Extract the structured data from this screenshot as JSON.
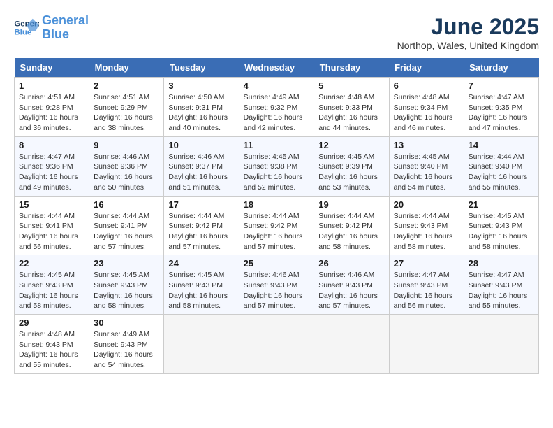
{
  "header": {
    "logo_line1": "General",
    "logo_line2": "Blue",
    "title": "June 2025",
    "subtitle": "Northop, Wales, United Kingdom"
  },
  "days_of_week": [
    "Sunday",
    "Monday",
    "Tuesday",
    "Wednesday",
    "Thursday",
    "Friday",
    "Saturday"
  ],
  "weeks": [
    [
      {
        "day": "1",
        "detail": "Sunrise: 4:51 AM\nSunset: 9:28 PM\nDaylight: 16 hours\nand 36 minutes."
      },
      {
        "day": "2",
        "detail": "Sunrise: 4:51 AM\nSunset: 9:29 PM\nDaylight: 16 hours\nand 38 minutes."
      },
      {
        "day": "3",
        "detail": "Sunrise: 4:50 AM\nSunset: 9:31 PM\nDaylight: 16 hours\nand 40 minutes."
      },
      {
        "day": "4",
        "detail": "Sunrise: 4:49 AM\nSunset: 9:32 PM\nDaylight: 16 hours\nand 42 minutes."
      },
      {
        "day": "5",
        "detail": "Sunrise: 4:48 AM\nSunset: 9:33 PM\nDaylight: 16 hours\nand 44 minutes."
      },
      {
        "day": "6",
        "detail": "Sunrise: 4:48 AM\nSunset: 9:34 PM\nDaylight: 16 hours\nand 46 minutes."
      },
      {
        "day": "7",
        "detail": "Sunrise: 4:47 AM\nSunset: 9:35 PM\nDaylight: 16 hours\nand 47 minutes."
      }
    ],
    [
      {
        "day": "8",
        "detail": "Sunrise: 4:47 AM\nSunset: 9:36 PM\nDaylight: 16 hours\nand 49 minutes."
      },
      {
        "day": "9",
        "detail": "Sunrise: 4:46 AM\nSunset: 9:36 PM\nDaylight: 16 hours\nand 50 minutes."
      },
      {
        "day": "10",
        "detail": "Sunrise: 4:46 AM\nSunset: 9:37 PM\nDaylight: 16 hours\nand 51 minutes."
      },
      {
        "day": "11",
        "detail": "Sunrise: 4:45 AM\nSunset: 9:38 PM\nDaylight: 16 hours\nand 52 minutes."
      },
      {
        "day": "12",
        "detail": "Sunrise: 4:45 AM\nSunset: 9:39 PM\nDaylight: 16 hours\nand 53 minutes."
      },
      {
        "day": "13",
        "detail": "Sunrise: 4:45 AM\nSunset: 9:40 PM\nDaylight: 16 hours\nand 54 minutes."
      },
      {
        "day": "14",
        "detail": "Sunrise: 4:44 AM\nSunset: 9:40 PM\nDaylight: 16 hours\nand 55 minutes."
      }
    ],
    [
      {
        "day": "15",
        "detail": "Sunrise: 4:44 AM\nSunset: 9:41 PM\nDaylight: 16 hours\nand 56 minutes."
      },
      {
        "day": "16",
        "detail": "Sunrise: 4:44 AM\nSunset: 9:41 PM\nDaylight: 16 hours\nand 57 minutes."
      },
      {
        "day": "17",
        "detail": "Sunrise: 4:44 AM\nSunset: 9:42 PM\nDaylight: 16 hours\nand 57 minutes."
      },
      {
        "day": "18",
        "detail": "Sunrise: 4:44 AM\nSunset: 9:42 PM\nDaylight: 16 hours\nand 57 minutes."
      },
      {
        "day": "19",
        "detail": "Sunrise: 4:44 AM\nSunset: 9:42 PM\nDaylight: 16 hours\nand 58 minutes."
      },
      {
        "day": "20",
        "detail": "Sunrise: 4:44 AM\nSunset: 9:43 PM\nDaylight: 16 hours\nand 58 minutes."
      },
      {
        "day": "21",
        "detail": "Sunrise: 4:45 AM\nSunset: 9:43 PM\nDaylight: 16 hours\nand 58 minutes."
      }
    ],
    [
      {
        "day": "22",
        "detail": "Sunrise: 4:45 AM\nSunset: 9:43 PM\nDaylight: 16 hours\nand 58 minutes."
      },
      {
        "day": "23",
        "detail": "Sunrise: 4:45 AM\nSunset: 9:43 PM\nDaylight: 16 hours\nand 58 minutes."
      },
      {
        "day": "24",
        "detail": "Sunrise: 4:45 AM\nSunset: 9:43 PM\nDaylight: 16 hours\nand 58 minutes."
      },
      {
        "day": "25",
        "detail": "Sunrise: 4:46 AM\nSunset: 9:43 PM\nDaylight: 16 hours\nand 57 minutes."
      },
      {
        "day": "26",
        "detail": "Sunrise: 4:46 AM\nSunset: 9:43 PM\nDaylight: 16 hours\nand 57 minutes."
      },
      {
        "day": "27",
        "detail": "Sunrise: 4:47 AM\nSunset: 9:43 PM\nDaylight: 16 hours\nand 56 minutes."
      },
      {
        "day": "28",
        "detail": "Sunrise: 4:47 AM\nSunset: 9:43 PM\nDaylight: 16 hours\nand 55 minutes."
      }
    ],
    [
      {
        "day": "29",
        "detail": "Sunrise: 4:48 AM\nSunset: 9:43 PM\nDaylight: 16 hours\nand 55 minutes."
      },
      {
        "day": "30",
        "detail": "Sunrise: 4:49 AM\nSunset: 9:43 PM\nDaylight: 16 hours\nand 54 minutes."
      },
      null,
      null,
      null,
      null,
      null
    ]
  ]
}
